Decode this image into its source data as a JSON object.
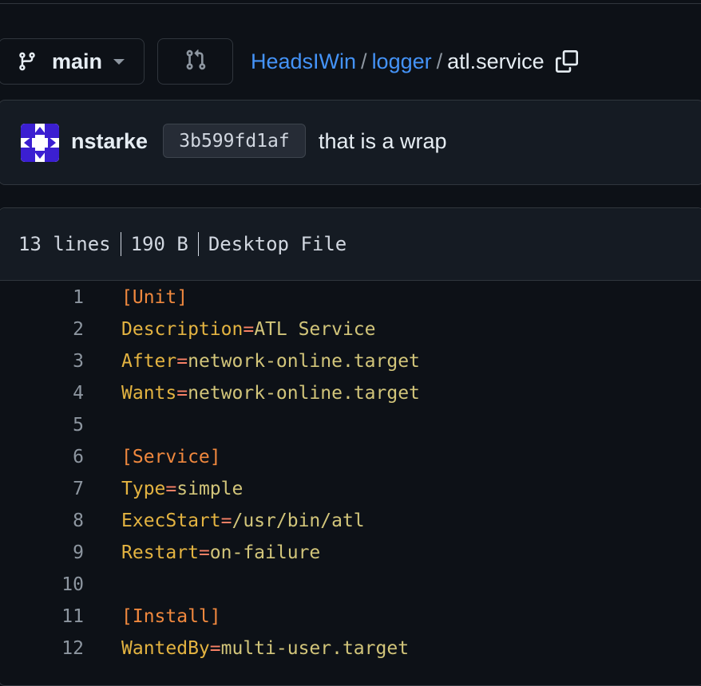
{
  "toolbar": {
    "branch": "main",
    "breadcrumb": {
      "owner": "HeadsIWin",
      "repo": "logger",
      "separator": "/",
      "file": "atl.service"
    }
  },
  "commit": {
    "author": "nstarke",
    "sha": "3b599fd1af",
    "message": "that is a wrap"
  },
  "file": {
    "lines": "13 lines",
    "size": "190 B",
    "type": "Desktop File"
  },
  "code_lines": [
    {
      "n": "1",
      "section": "[Unit]"
    },
    {
      "n": "2",
      "key": "Description",
      "value": "ATL Service"
    },
    {
      "n": "3",
      "key": "After",
      "value": "network-online.target"
    },
    {
      "n": "4",
      "key": "Wants",
      "value": "network-online.target"
    },
    {
      "n": "5"
    },
    {
      "n": "6",
      "section": "[Service]"
    },
    {
      "n": "7",
      "key": "Type",
      "value": "simple"
    },
    {
      "n": "8",
      "key": "ExecStart",
      "value": "/usr/bin/atl"
    },
    {
      "n": "9",
      "key": "Restart",
      "value": "on-failure"
    },
    {
      "n": "10"
    },
    {
      "n": "11",
      "section": "[Install]"
    },
    {
      "n": "12",
      "key": "WantedBy",
      "value": "multi-user.target"
    }
  ],
  "colors": {
    "background": "#0d1117",
    "link": "#4493f8",
    "key": "#e3b341",
    "section": "#f0883e"
  },
  "icons": {
    "branch": "git-branch-icon",
    "pull_request": "git-pull-request-icon",
    "copy": "copy-icon",
    "avatar": "identicon-avatar"
  }
}
